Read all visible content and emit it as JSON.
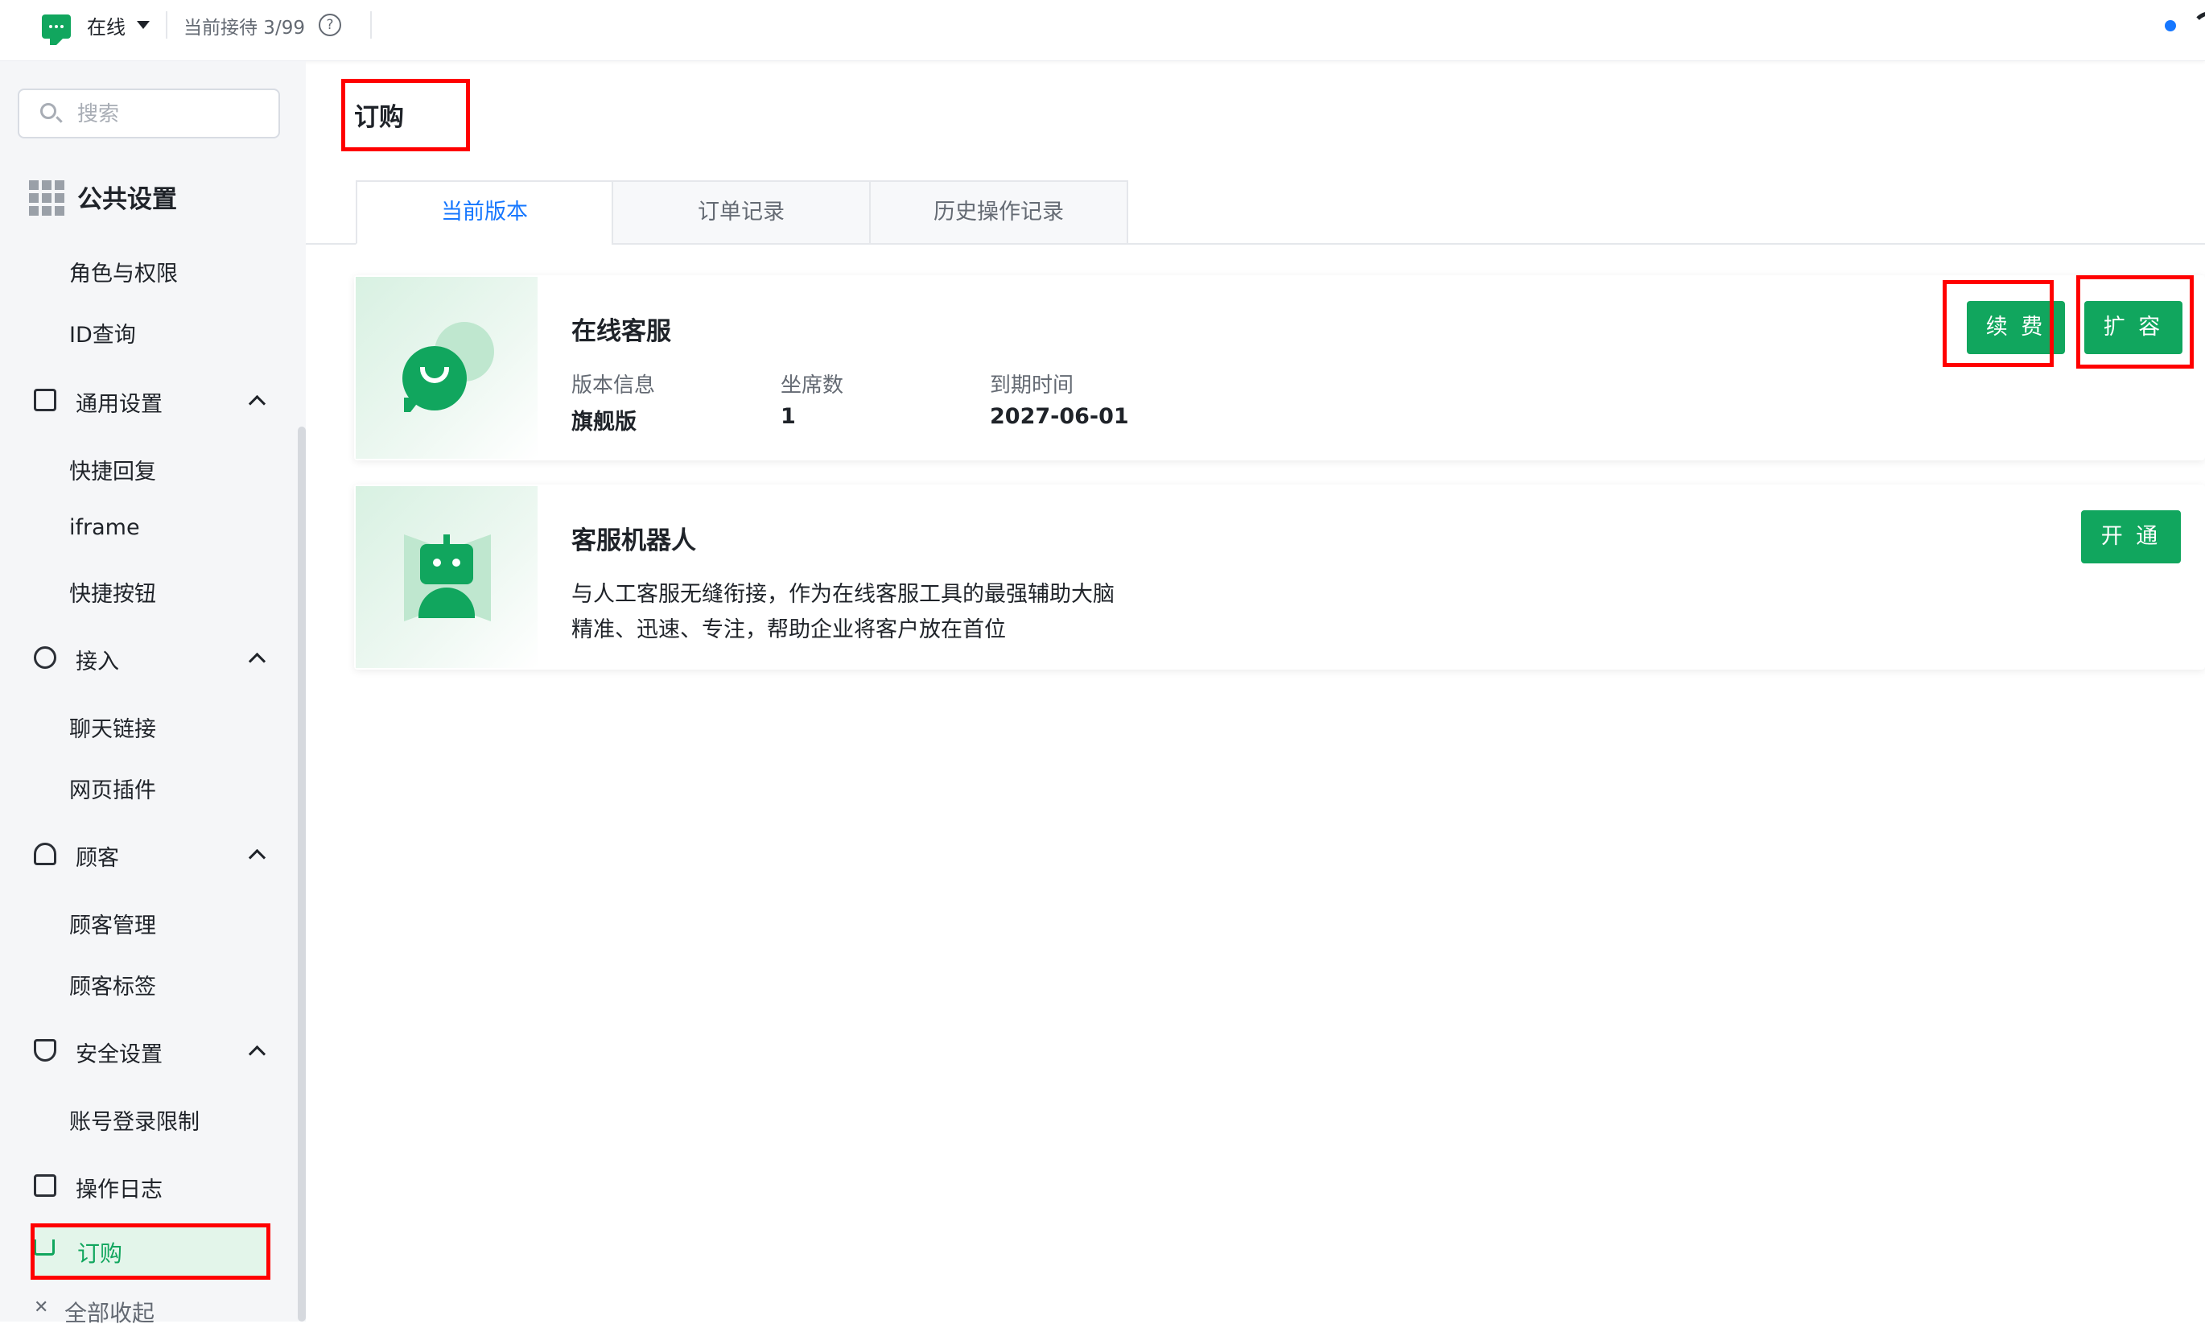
{
  "topbar": {
    "status": "在线",
    "reception": "当前接待 3/99",
    "help_glyph": "?"
  },
  "sidebar": {
    "search_placeholder": "搜索",
    "section": "公共设置",
    "items": {
      "roles": "角色与权限",
      "id_query": "ID查询",
      "general": "通用设置",
      "quick_reply": "快捷回复",
      "iframe": "iframe",
      "quick_button": "快捷按钮",
      "access": "接入",
      "chat_link": "聊天链接",
      "web_plugin": "网页插件",
      "customer": "顾客",
      "customer_mgmt": "顾客管理",
      "customer_tags": "顾客标签",
      "security": "安全设置",
      "login_limit": "账号登录限制",
      "op_log": "操作日志",
      "order": "订购"
    },
    "collapse_all": "全部收起"
  },
  "main": {
    "title": "订购",
    "tabs": [
      "当前版本",
      "订单记录",
      "历史操作记录"
    ],
    "cards": {
      "online_service": {
        "title": "在线客服",
        "version_label": "版本信息",
        "version_value": "旗舰版",
        "seats_label": "坐席数",
        "seats_value": "1",
        "expire_label": "到期时间",
        "expire_value": "2027-06-01",
        "renew_label": "续 费",
        "expand_label": "扩 容"
      },
      "robot": {
        "title": "客服机器人",
        "desc1": "与人工客服无缝衔接，作为在线客服工具的最强辅助大脑",
        "desc2": "精准、迅速、专注，帮助企业将客户放在首位",
        "open_label": "开 通"
      }
    }
  },
  "colors": {
    "brand_green": "#11a65e",
    "tab_active": "#1677ff",
    "annotation_red": "#ff0000"
  }
}
